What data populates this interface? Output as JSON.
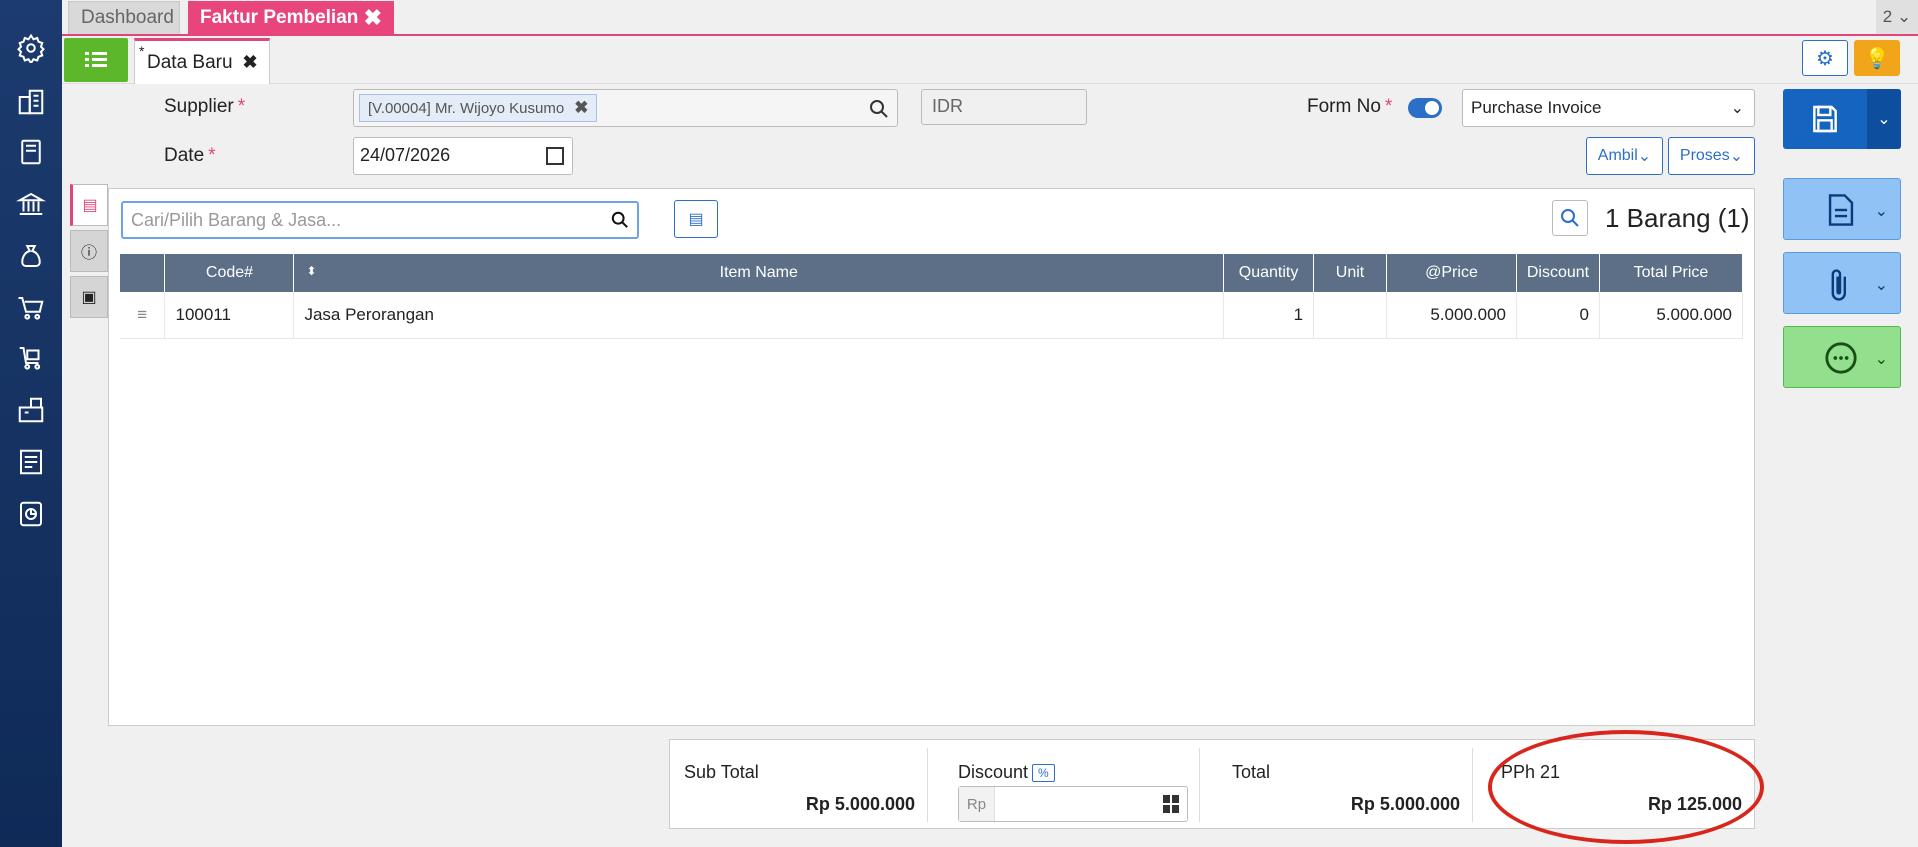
{
  "top_tabs": {
    "dashboard": "Dashboard",
    "faktur": "Faktur Pembelian",
    "faktur_close": "✖",
    "window_count": "2 ⌄"
  },
  "sub_tab": {
    "star": "*",
    "label": "Data Baru",
    "close": "✖"
  },
  "form": {
    "supplier_label": "Supplier",
    "required_mark": "*",
    "supplier_value": "[V.00004] Mr. Wijoyo Kusumo",
    "supplier_clear": "✖",
    "currency": "IDR",
    "form_no_label": "Form No",
    "form_type": "Purchase Invoice",
    "date_label": "Date",
    "date_value": "24/07/2026",
    "ambil_label": "Ambil",
    "proses_label": "Proses"
  },
  "items": {
    "search_placeholder": "Cari/Pilih Barang & Jasa...",
    "count_label": "1 Barang (1)",
    "columns": [
      "Code#",
      "Item Name",
      "Quantity",
      "Unit",
      "@Price",
      "Discount",
      "Total Price"
    ],
    "rows": [
      {
        "code": "100011",
        "name": "Jasa Perorangan",
        "quantity": "1",
        "unit": "",
        "price": "5.000.000",
        "discount": "0",
        "total": "5.000.000"
      }
    ]
  },
  "summary": {
    "subtotal_label": "Sub Total",
    "subtotal_value": "Rp 5.000.000",
    "discount_label": "Discount",
    "discount_pct": "%",
    "discount_prefix": "Rp",
    "total_label": "Total",
    "total_value": "Rp 5.000.000",
    "pph_label": "PPh 21",
    "pph_value": "Rp 125.000"
  },
  "colors": {
    "accent_pink": "#e8457d",
    "primary_blue": "#1565c0",
    "green": "#5cb82a",
    "annotation_red": "#d9261c"
  }
}
